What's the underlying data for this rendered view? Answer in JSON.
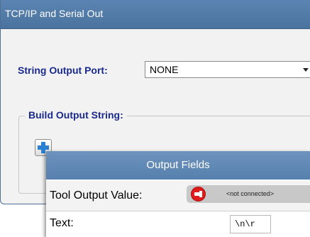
{
  "window": {
    "title": "TCP/IP and Serial Out"
  },
  "port": {
    "label": "String Output Port:",
    "value": "NONE"
  },
  "build": {
    "legend": "Build Output String:"
  },
  "output_fields": {
    "title": "Output Fields",
    "rows": [
      {
        "label": "Tool Output Value:",
        "status": "<not connected>",
        "icon": "unplugged-icon"
      },
      {
        "label": "Text:",
        "value": "\\n\\r"
      }
    ]
  },
  "colors": {
    "title_bar": "#4a739f",
    "label_text": "#1a2a8c",
    "disconnected": "#e01b1b"
  }
}
